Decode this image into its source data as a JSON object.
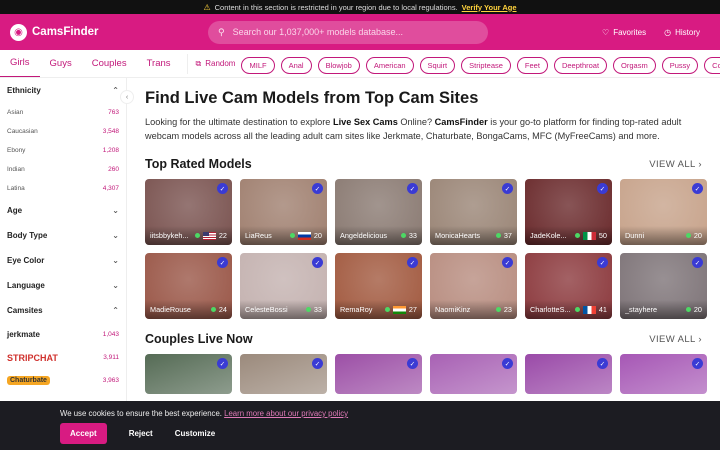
{
  "notice": {
    "text": "Content in this section is restricted in your region due to local regulations.",
    "link": "Verify Your Age"
  },
  "header": {
    "brand": "CamsFinder",
    "search_placeholder": "Search our 1,037,000+ models database...",
    "favorites": "Favorites",
    "history": "History"
  },
  "tabs": [
    "Girls",
    "Guys",
    "Couples",
    "Trans"
  ],
  "random": "Random",
  "tags": [
    "MILF",
    "Anal",
    "Blowjob",
    "American",
    "Squirt",
    "Striptease",
    "Feet",
    "Deepthroat",
    "Orgasm",
    "Pussy",
    "Cosplay",
    "Cu"
  ],
  "sidebar": {
    "ethnicity": {
      "title": "Ethnicity",
      "rows": [
        {
          "label": "Asian",
          "count": "763"
        },
        {
          "label": "Caucasian",
          "count": "3,548"
        },
        {
          "label": "Ebony",
          "count": "1,208"
        },
        {
          "label": "Indian",
          "count": "260"
        },
        {
          "label": "Latina",
          "count": "4,307"
        }
      ]
    },
    "age": "Age",
    "body": "Body Type",
    "eye": "Eye Color",
    "language": "Language",
    "camsites": {
      "title": "Camsites",
      "sites": [
        {
          "name": "jerkmate",
          "count": "1,043"
        },
        {
          "name": "STRIPCHAT",
          "count": "3,911"
        },
        {
          "name": "Chaturbate",
          "count": "3,963"
        }
      ]
    }
  },
  "main": {
    "title": "Find Live Cam Models from Top Cam Sites",
    "intro": {
      "a": "Looking for the ultimate destination to explore ",
      "b": "Live Sex Cams",
      "c": " Online? ",
      "d": "CamsFinder",
      "e": " is your go-to platform for finding top-rated adult webcam models across all the leading adult cam sites like Jerkmate, Chaturbate, BongaCams, MFC (MyFreeCams) and more."
    },
    "top_rated": "Top Rated Models",
    "couples": "Couples Live Now",
    "view_all": "VIEW ALL"
  },
  "models": [
    {
      "name": "iitsbbykeh...",
      "age": "22",
      "flag": "us",
      "bg": "#7a5350"
    },
    {
      "name": "LiaReus",
      "age": "20",
      "flag": "ru",
      "bg": "#a08070"
    },
    {
      "name": "Angeldelicious",
      "age": "33",
      "flag": "",
      "bg": "#8a7a72"
    },
    {
      "name": "MonicaHearts",
      "age": "37",
      "flag": "",
      "bg": "#9a8576"
    },
    {
      "name": "JadeKole...",
      "age": "50",
      "flag": "it",
      "bg": "#6a2a2c"
    },
    {
      "name": "Dunni",
      "age": "20",
      "flag": "",
      "bg": "#c7a38b"
    },
    {
      "name": "MadieRouse",
      "age": "24",
      "flag": "",
      "bg": "#9a5748"
    },
    {
      "name": "CelesteBossi",
      "age": "33",
      "flag": "",
      "bg": "#c4b2b0"
    },
    {
      "name": "RemaRoy",
      "age": "27",
      "flag": "in",
      "bg": "#a25a40"
    },
    {
      "name": "NaomiKinz",
      "age": "23",
      "flag": "",
      "bg": "#b88d80"
    },
    {
      "name": "CharlotteS...",
      "age": "41",
      "flag": "fr",
      "bg": "#8c3a3e"
    },
    {
      "name": "_stayhere",
      "age": "20",
      "flag": "",
      "bg": "#7e7478"
    }
  ],
  "couples_cards": [
    "#556b55",
    "#9b8a7c",
    "#9c4fa6",
    "#a861b4",
    "#9a4aa8",
    "#a657b5"
  ],
  "cookie": {
    "text": "We use cookies to ensure the best experience.",
    "link": "Learn more about our privacy policy",
    "accept": "Accept",
    "reject": "Reject",
    "customize": "Customize"
  }
}
